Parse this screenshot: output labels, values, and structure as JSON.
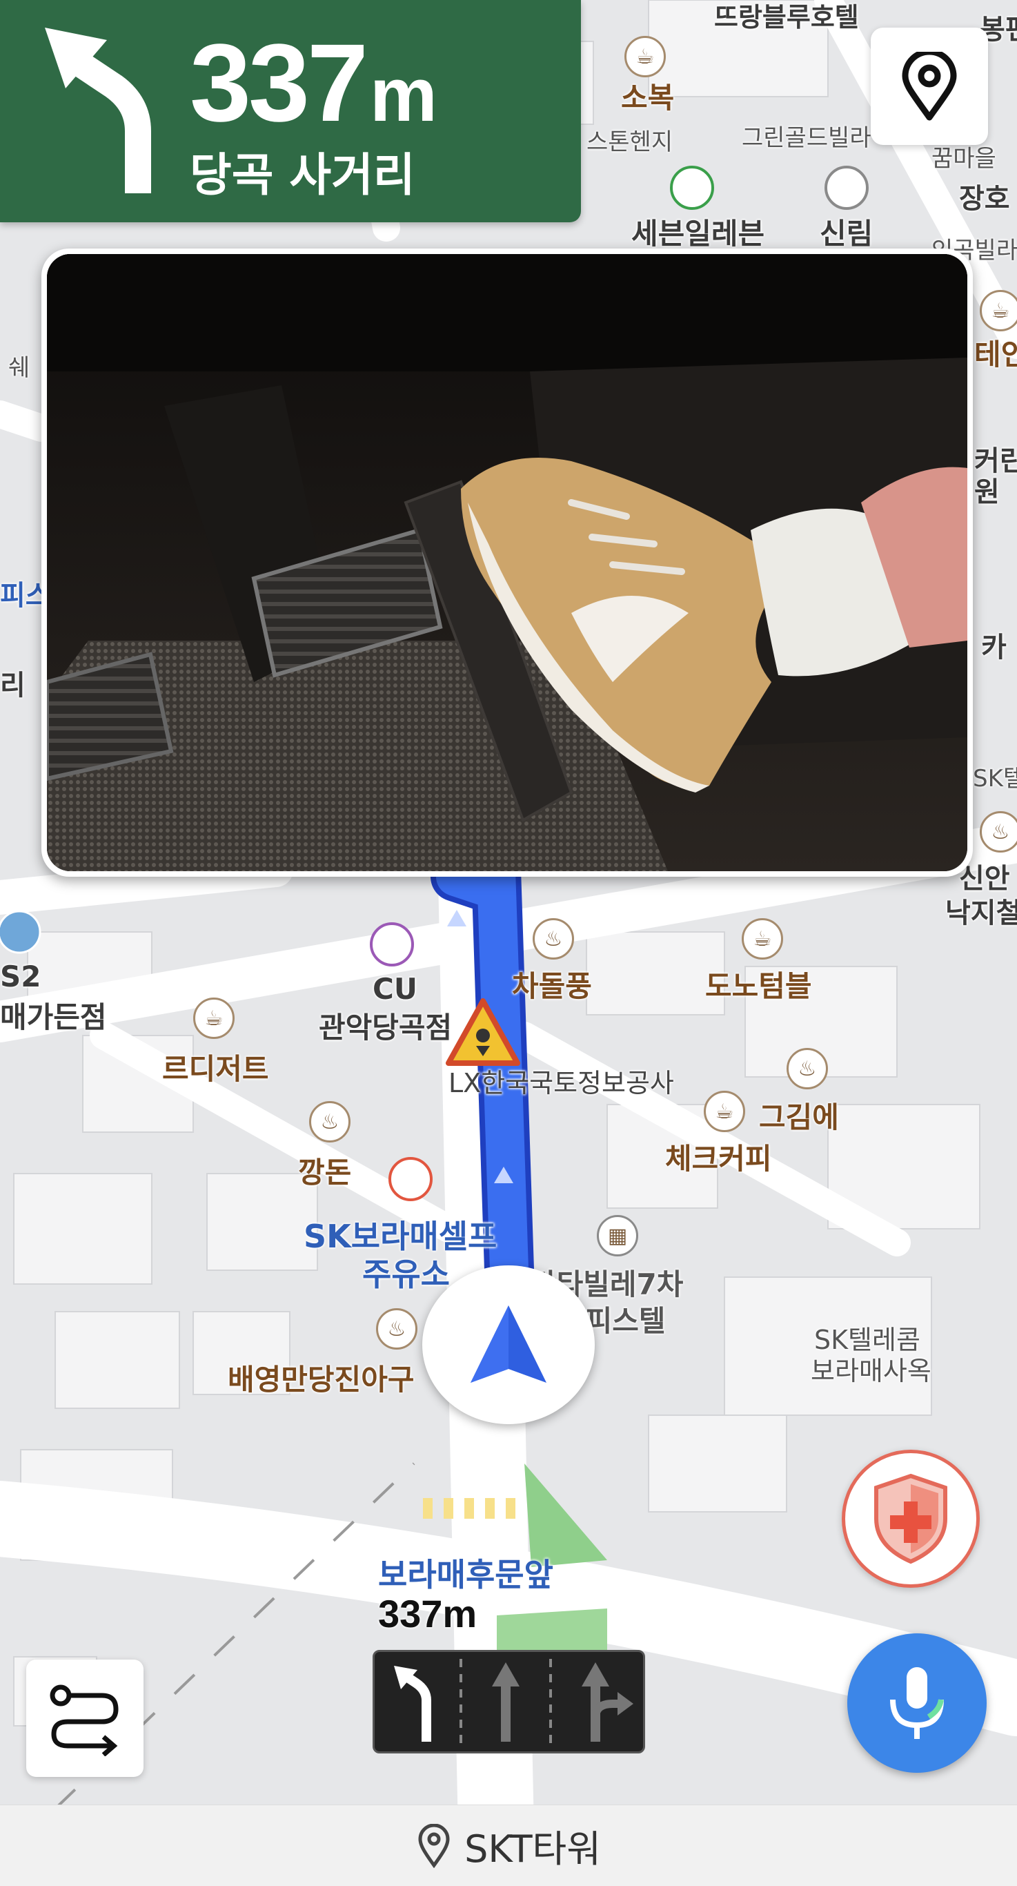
{
  "guidance": {
    "distance": "337",
    "unit": "m",
    "road_name": "당곡 사거리",
    "maneuver_icon": "turn-left-arrow-icon"
  },
  "map_labels": {
    "top_store": "뜨랑블루호텔",
    "top_right": "봉편",
    "sobok": "소복",
    "stonehenge": "스톤헨지",
    "green_gold": "그린골드빌라",
    "kkum": "꿈마을",
    "janghoe": "장호",
    "seven_eleven": "세븐일레븐",
    "sinrim": "신림",
    "ingong": "인곡빌라",
    "left_1": "쉐",
    "left_2": "피스",
    "left_3": "리",
    "right_1": "테인",
    "right_2": "커린",
    "right_3": "원",
    "right_4": "카",
    "right_5": "SK텔",
    "right_6": "신안",
    "right_7": "낙지철",
    "gs25_store": "S2",
    "gs25_sub": "매가든점",
    "cu": "CU",
    "cu_sub": "관악당곡점",
    "chadolpung": "차돌풍",
    "donoteumbeul": "도노텀블",
    "kr_dessert": "르디저트",
    "lx": "LX한국국토정보공사",
    "geugime": "그김에",
    "check_coffee": "체크커피",
    "kkangdon": "깡돈",
    "sk_station_1": "SK보라매셀프",
    "sk_station_2": "주유소",
    "kantavil_1": "칸타빌레7차",
    "kantavil_2": "오피스텔",
    "sktelecom_1": "SK텔레콤",
    "sktelecom_2": "보라매사옥",
    "baeyoung": "배영만당진아구"
  },
  "lane_guide": {
    "intersection": "보라매후문앞",
    "distance": "337m"
  },
  "destination": {
    "name": "SKT타워"
  },
  "colors": {
    "banner_green": "#2f6a45",
    "route_blue": "#2f5fe0",
    "mic_blue": "#3c86e8",
    "safety_red": "#e46a5a"
  }
}
